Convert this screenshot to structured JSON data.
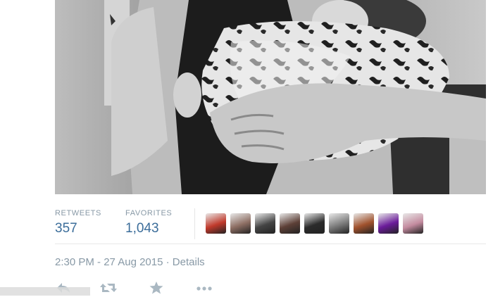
{
  "tweet": {
    "photo": {
      "alt": "",
      "tone": "grayscale"
    },
    "stats": {
      "retweets_label": "RETWEETS",
      "retweets_value": "357",
      "favorites_label": "FAVORITES",
      "favorites_value": "1,043"
    },
    "favoriters": [
      {
        "name": "favoriter-1",
        "color": "#c0392b"
      },
      {
        "name": "favoriter-2",
        "color": "#8d6e63"
      },
      {
        "name": "favoriter-3",
        "color": "#444444"
      },
      {
        "name": "favoriter-4",
        "color": "#5d4037"
      },
      {
        "name": "favoriter-5",
        "color": "#2b2b2b"
      },
      {
        "name": "favoriter-6",
        "color": "#7b7b7b"
      },
      {
        "name": "favoriter-7",
        "color": "#a0522d"
      },
      {
        "name": "favoriter-8",
        "color": "#6a1b9a"
      },
      {
        "name": "favoriter-9",
        "color": "#c48b9f"
      }
    ],
    "timestamp": {
      "time": "2:30 PM - 27 Aug 2015",
      "separator": " · ",
      "details_link": "Details"
    },
    "actions": {
      "reply_icon": "reply-icon",
      "retweet_icon": "retweet-icon",
      "favorite_icon": "star-icon",
      "more_icon": "more-icon"
    },
    "colors": {
      "label_gray": "#8899a6",
      "count_blue": "#3b6d9a",
      "icon_gray": "#aab8c2"
    }
  }
}
